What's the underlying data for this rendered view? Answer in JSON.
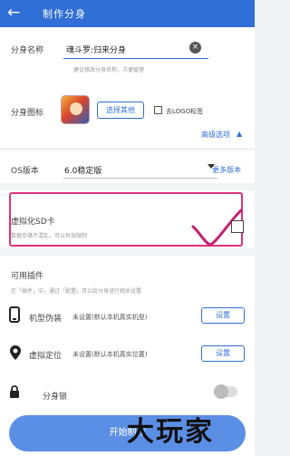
{
  "header": {
    "title": "制作分身"
  },
  "clone_name": {
    "label": "分身名称",
    "value": "魂斗罗:归来分身",
    "hint": "建议修改分身名称，方便管理"
  },
  "clone_icon": {
    "label": "分身图标",
    "choose_label": "选择其他",
    "no_logo_label": "去LOGO标签",
    "no_logo_checked": false
  },
  "advanced": {
    "label": "高级选项"
  },
  "os": {
    "label": "OS版本",
    "value": "6.0稳定版",
    "more_label": "更多版本"
  },
  "virtual_sd": {
    "label": "虚拟化SD卡",
    "desc": "数据存储不混乱，可以有效限制",
    "checked": false
  },
  "plugins": {
    "heading": "可用插件",
    "desc": "在「插件」中，通过「配置」可以给分身进行相关设置",
    "items": [
      {
        "label": "机型伪装",
        "status": "未设置(默认本机真实机型)",
        "button": "设置"
      },
      {
        "label": "虚拟定位",
        "status": "未设置(默认本机真实位置)",
        "button": "设置"
      }
    ],
    "lock_label": "分身锁",
    "lock_on": false
  },
  "footer": {
    "make_button": "开始制作"
  },
  "watermark": "大玩家",
  "colors": {
    "primary": "#2f6fd6",
    "highlight": "#e0317a"
  }
}
